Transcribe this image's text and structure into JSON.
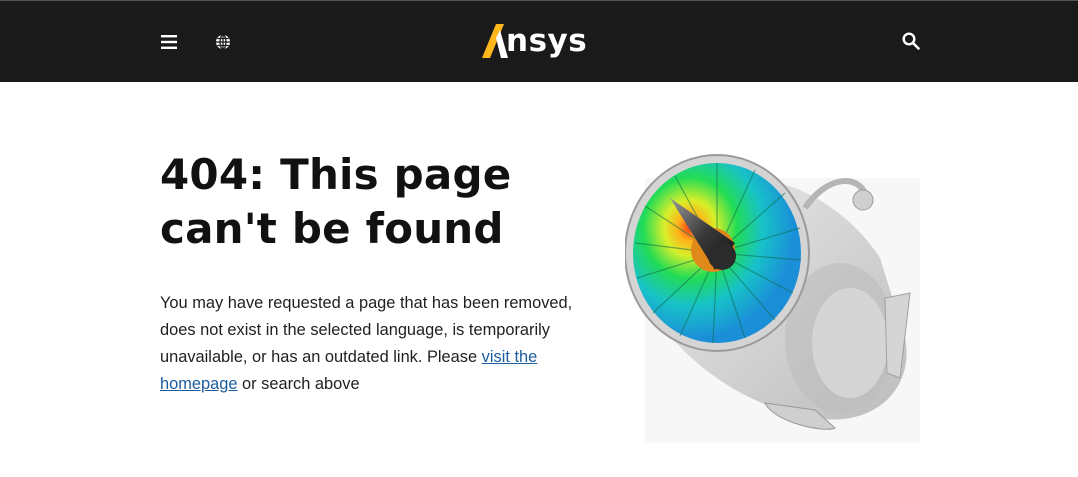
{
  "header": {
    "logo_text": "nsys",
    "logo_accent_color": "#FFB71B",
    "menu_icon": "menu-icon",
    "globe_icon": "globe-icon",
    "search_icon": "search-icon",
    "background": "#1a1a1a"
  },
  "error": {
    "headline_line1": "404: This page",
    "headline_line2": "can't be found",
    "message_pre": "You may have requested a page that has been removed, does not exist in the selected language, is temporarily unavailable, or has an outdated link. Please ",
    "link_text": "visit the homepage",
    "message_post": " or search above",
    "link_color": "#1b5c9e"
  },
  "hero_image": {
    "icon": "jet-engine-simulation-illustration"
  }
}
